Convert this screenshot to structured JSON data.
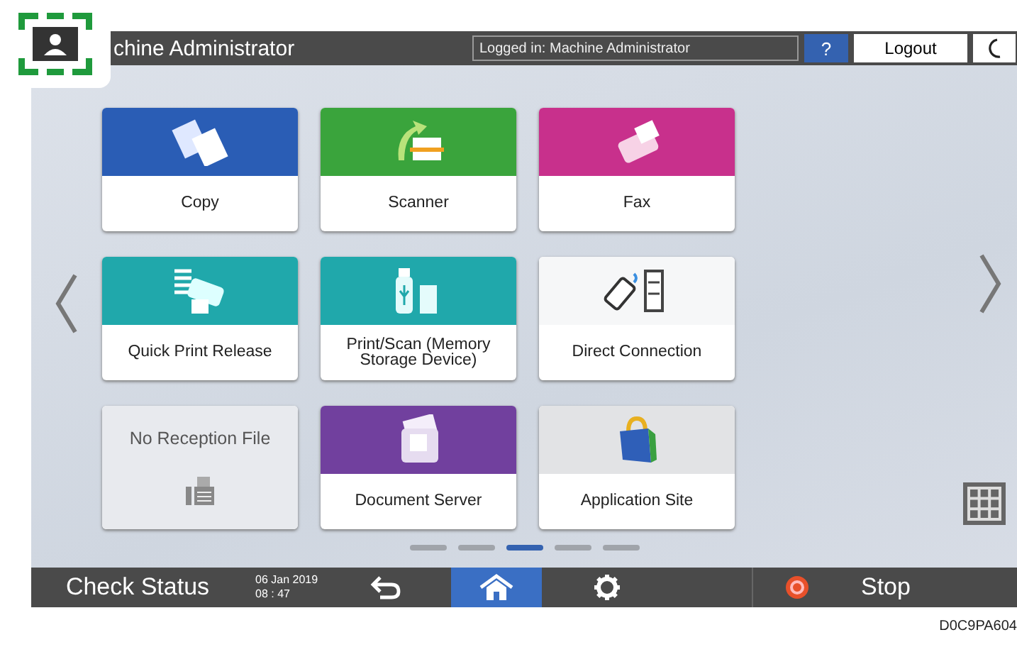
{
  "top_bar": {
    "title": "chine Administrator",
    "login_status": "Logged in: Machine Administrator",
    "help": "?",
    "logout": "Logout"
  },
  "tiles": [
    {
      "kind": "app",
      "label": "Copy",
      "color": "#2a5db5"
    },
    {
      "kind": "app",
      "label": "Scanner",
      "color": "#3aa43c"
    },
    {
      "kind": "app",
      "label": "Fax",
      "color": "#c8308c"
    },
    {
      "kind": "app",
      "label": "Quick Print Release",
      "color": "#20a8ab"
    },
    {
      "kind": "app",
      "label": "Print/Scan (Memory Storage Device)",
      "color": "#20a8ab"
    },
    {
      "kind": "app",
      "label": "Direct Connection",
      "color": "#f6f7f8"
    },
    {
      "kind": "status",
      "label": "No Reception File",
      "color": "#e8eaee"
    },
    {
      "kind": "app",
      "label": "Document Server",
      "color": "#71409e"
    },
    {
      "kind": "app",
      "label": "Application Site",
      "color": "#e2e3e5"
    }
  ],
  "pages": [
    {
      "selected": false
    },
    {
      "selected": false
    },
    {
      "selected": true
    },
    {
      "selected": false
    },
    {
      "selected": false
    }
  ],
  "bottom_bar": {
    "check_status": "Check Status",
    "date": "06 Jan 2019",
    "time": "08 : 47",
    "nav_buttons": [
      {
        "kind": "back",
        "selected": false
      },
      {
        "kind": "home",
        "selected": true
      },
      {
        "kind": "settings",
        "selected": false
      }
    ],
    "stop": "Stop"
  },
  "caption": "D0C9PA604"
}
